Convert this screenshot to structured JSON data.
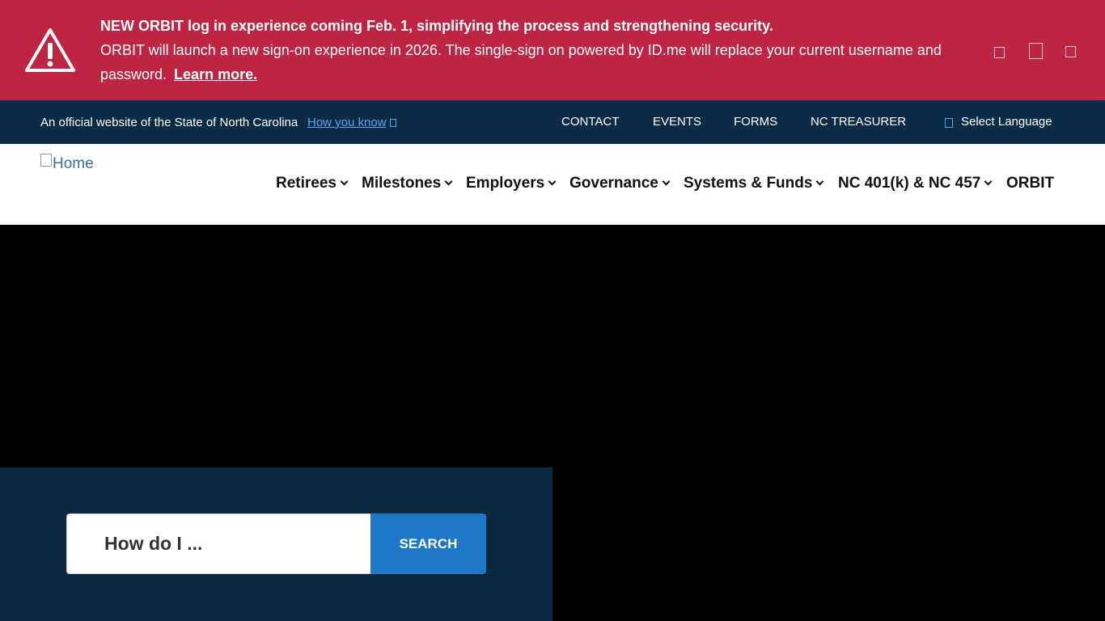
{
  "alert": {
    "icon": "warning-triangle-icon",
    "title": "NEW ORBIT log in experience coming Feb. 1, simplifying the process and strengthening security.",
    "body": "ORBIT will launch a new sign-on experience in 2026. The single-sign on powered by ID.me will replace your current username and password.",
    "link": "Learn more.",
    "controls": [
      "prev-icon",
      "pause-icon",
      "next-icon"
    ],
    "color": "#bf2443"
  },
  "utility": {
    "official_text": "An official website of the State of North Carolina",
    "how_you_know": "How you know",
    "links": [
      "CONTACT",
      "EVENTS",
      "FORMS",
      "NC TREASURER"
    ],
    "language": "Select Language",
    "color": "#0b2b47"
  },
  "header": {
    "logo_alt": "Home",
    "nav": [
      {
        "label": "Retirees",
        "dropdown": true
      },
      {
        "label": "Milestones",
        "dropdown": true
      },
      {
        "label": "Employers",
        "dropdown": true
      },
      {
        "label": "Governance",
        "dropdown": true
      },
      {
        "label": "Systems & Funds",
        "dropdown": true
      },
      {
        "label": "NC 401(k) & NC 457",
        "dropdown": true
      },
      {
        "label": "ORBIT",
        "dropdown": false
      }
    ]
  },
  "search": {
    "placeholder": "How do I ...",
    "button": "SEARCH",
    "button_color": "#1e78c8",
    "panel_color": "#0b2742"
  }
}
